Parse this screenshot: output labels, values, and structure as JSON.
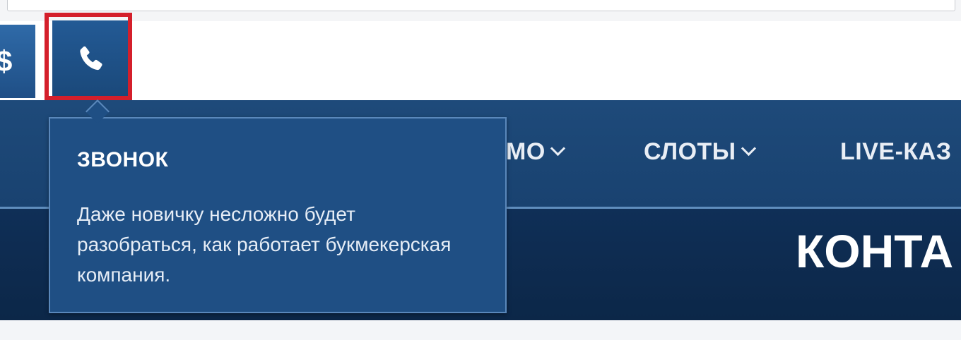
{
  "toolbar": {
    "dollar_symbol": "$",
    "dollar_icon": "dollar-icon",
    "phone_icon": "phone-icon"
  },
  "nav": {
    "items": [
      {
        "label": "МО",
        "has_dropdown": true
      },
      {
        "label": "СЛОТЫ",
        "has_dropdown": true
      },
      {
        "label": "LIVE-КАЗ",
        "has_dropdown": false
      }
    ]
  },
  "hero": {
    "title": "КОНТА"
  },
  "tooltip": {
    "title": "ЗВОНОК",
    "body": "Даже новичку несложно будет разобраться, как работает букмекерская компания."
  },
  "colors": {
    "nav_bg": "#1e4a7a",
    "hero_bg": "#0f2f57",
    "tooltip_bg": "#1f4f84",
    "highlight_border": "#d41f2b",
    "text_light": "#e9eef5"
  }
}
